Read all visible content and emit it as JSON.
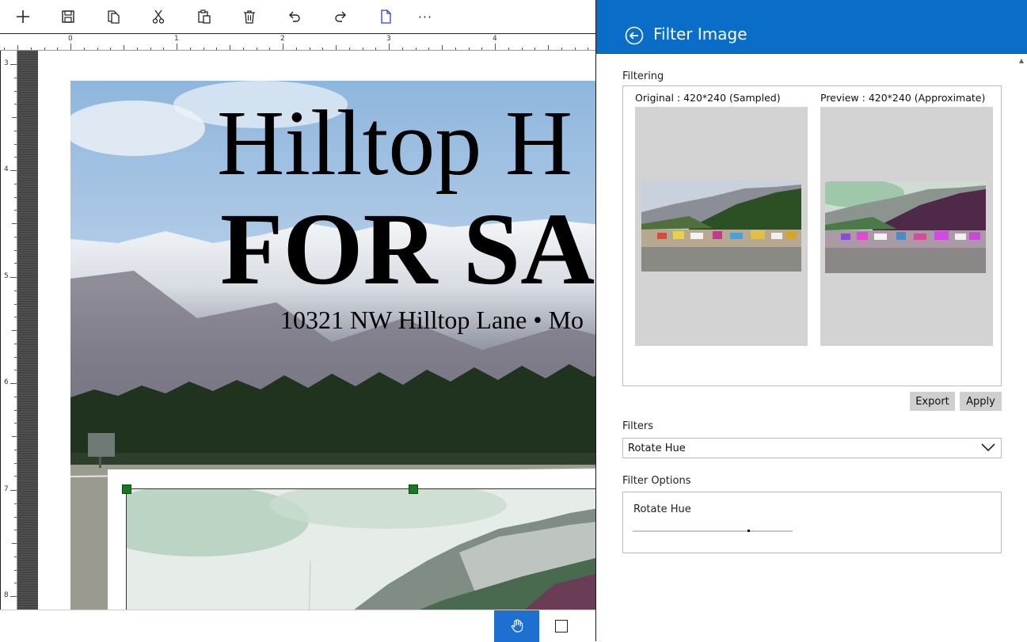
{
  "toolbar": {
    "icons": [
      "add-icon",
      "save-icon",
      "copy-icon",
      "cut-icon",
      "paste-icon",
      "delete-icon",
      "undo-icon",
      "redo-icon",
      "page-icon"
    ],
    "more_label": "···"
  },
  "rulers": {
    "horizontal_labels": [
      "0",
      "1",
      "2",
      "3",
      "4"
    ],
    "vertical_labels": [
      "3",
      "4",
      "5",
      "6",
      "7",
      "8"
    ]
  },
  "poster": {
    "title": "Hilltop H",
    "subtitle": "FOR SA",
    "address": "10321 NW Hilltop Lane • Mo"
  },
  "panel": {
    "title": "Filter Image",
    "filtering_label": "Filtering",
    "original_caption": "Original : 420*240  (Sampled)",
    "preview_caption": "Preview : 420*240  (Approximate)",
    "export_label": "Export",
    "apply_label": "Apply",
    "filters_label": "Filters",
    "selected_filter": "Rotate Hue",
    "filter_options_label": "Filter Options",
    "option_name": "Rotate Hue",
    "option_value": 0.72
  },
  "colors": {
    "header_blue": "#0a6ec9",
    "active_tool_blue": "#1e70d0",
    "handle_green": "#157a20"
  }
}
